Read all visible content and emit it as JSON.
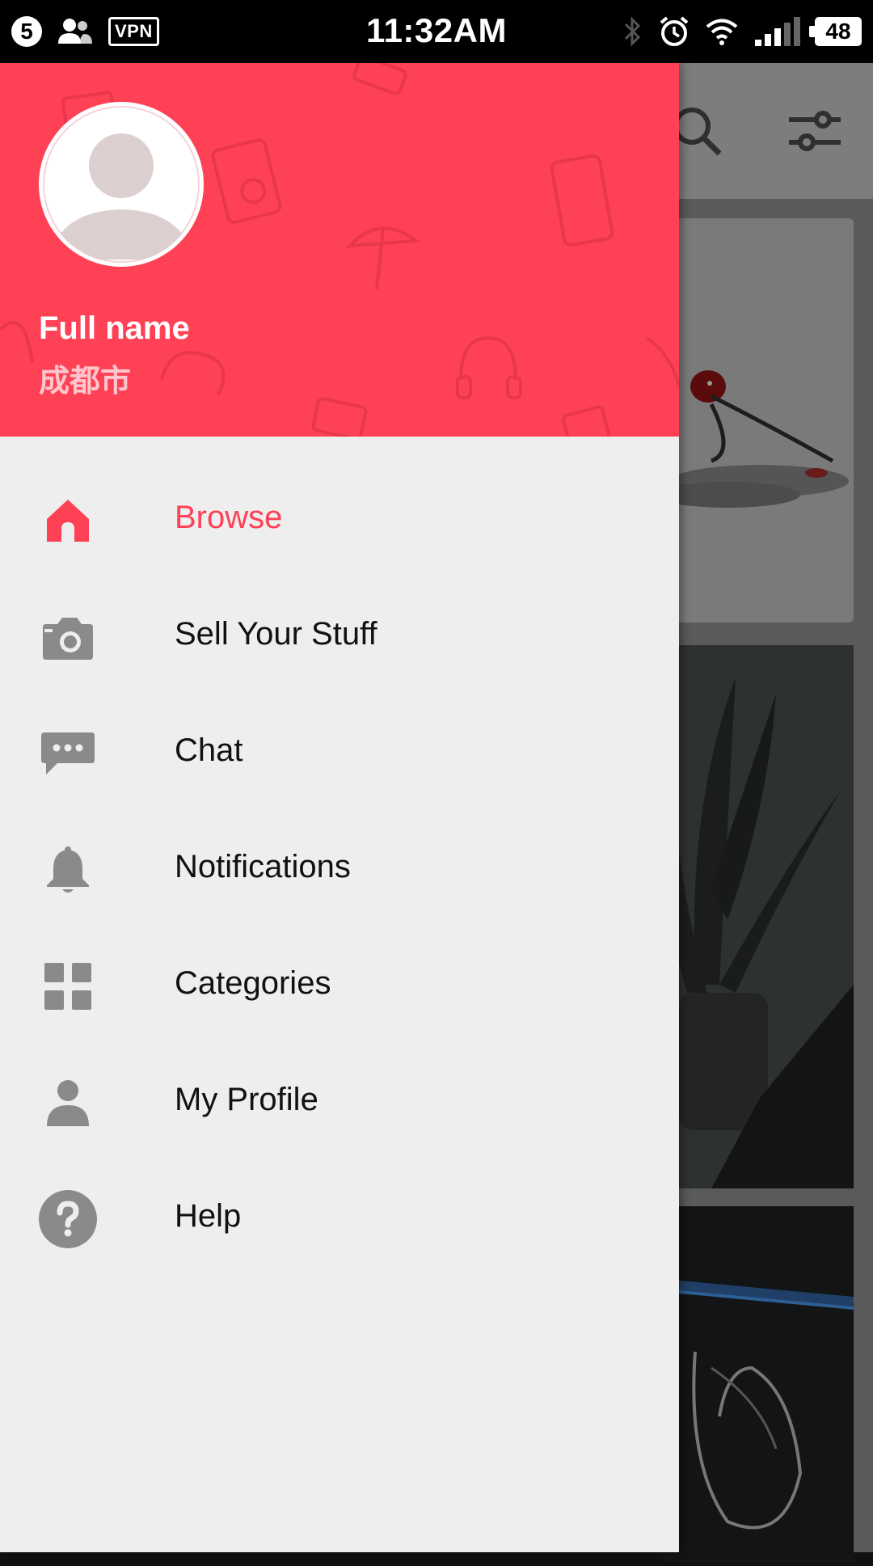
{
  "status_bar": {
    "notification_count": "5",
    "vpn_label": "VPN",
    "time": "11:32AM",
    "battery": "48"
  },
  "drawer": {
    "header": {
      "full_name": "Full name",
      "city": "成都市",
      "accent_color": "#ff4156"
    },
    "menu": [
      {
        "label": "Browse",
        "icon": "home-icon",
        "active": true
      },
      {
        "label": "Sell Your Stuff",
        "icon": "camera-icon",
        "active": false
      },
      {
        "label": "Chat",
        "icon": "chat-icon",
        "active": false
      },
      {
        "label": "Notifications",
        "icon": "bell-icon",
        "active": false
      },
      {
        "label": "Categories",
        "icon": "grid-icon",
        "active": false
      },
      {
        "label": "My Profile",
        "icon": "person-icon",
        "active": false
      },
      {
        "label": "Help",
        "icon": "help-icon",
        "active": false
      }
    ]
  },
  "background": {
    "toolbar_icons": [
      "search-icon",
      "filter-sliders-icon"
    ]
  }
}
